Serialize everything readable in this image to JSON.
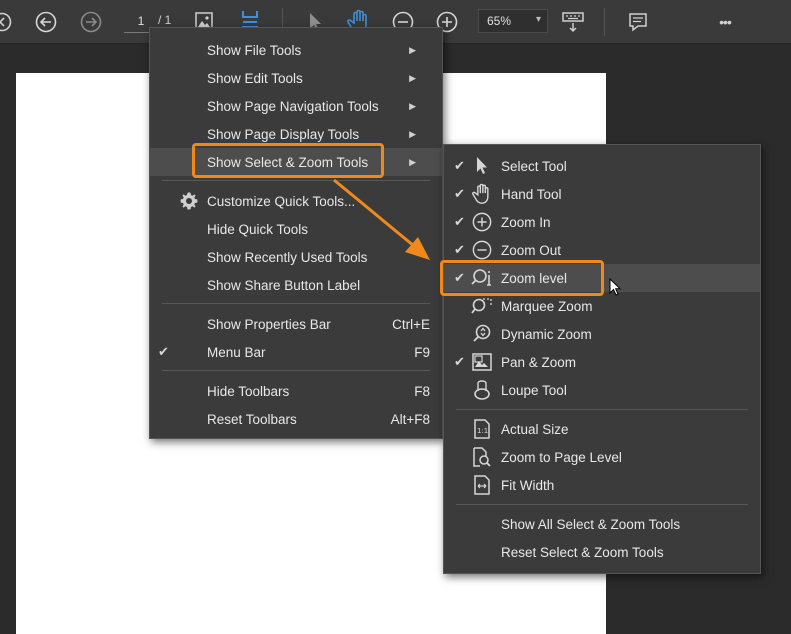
{
  "toolbar": {
    "page_current": "1",
    "page_total": "/ 1",
    "zoom": "65%",
    "zoom_caret": "▾",
    "more": "•••"
  },
  "main_menu": {
    "items": [
      {
        "label": "Show File Tools",
        "arrow": "▶"
      },
      {
        "label": "Show Edit Tools",
        "arrow": "▶"
      },
      {
        "label": "Show Page Navigation Tools",
        "arrow": "▶"
      },
      {
        "label": "Show Page Display Tools",
        "arrow": "▶"
      },
      {
        "label": "Show Select & Zoom Tools",
        "arrow": "▶"
      },
      {
        "label": "Customize Quick Tools..."
      },
      {
        "label": "Hide Quick Tools"
      },
      {
        "label": "Show Recently Used Tools"
      },
      {
        "label": "Show Share Button Label"
      },
      {
        "label": "Show Properties Bar",
        "shortcut": "Ctrl+E"
      },
      {
        "label": "Menu Bar",
        "shortcut": "F9",
        "check": "✔"
      },
      {
        "label": "Hide Toolbars",
        "shortcut": "F8"
      },
      {
        "label": "Reset Toolbars",
        "shortcut": "Alt+F8"
      }
    ]
  },
  "sub_menu": {
    "items": [
      {
        "label": "Select Tool",
        "check": "✔",
        "icon": "pointer-icon"
      },
      {
        "label": "Hand Tool",
        "check": "✔",
        "icon": "hand-icon"
      },
      {
        "label": "Zoom In",
        "check": "✔",
        "icon": "zoom-in-icon"
      },
      {
        "label": "Zoom Out",
        "check": "✔",
        "icon": "zoom-out-icon"
      },
      {
        "label": "Zoom level",
        "check": "✔",
        "icon": "zoom-level-icon"
      },
      {
        "label": "Marquee Zoom",
        "icon": "marquee-zoom-icon"
      },
      {
        "label": "Dynamic Zoom",
        "icon": "dynamic-zoom-icon"
      },
      {
        "label": "Pan & Zoom",
        "check": "✔",
        "icon": "pan-zoom-icon"
      },
      {
        "label": "Loupe Tool",
        "icon": "loupe-icon"
      },
      {
        "label": "Actual Size",
        "icon": "actual-size-icon"
      },
      {
        "label": "Zoom to Page Level",
        "icon": "zoom-page-icon"
      },
      {
        "label": "Fit Width",
        "icon": "fit-width-icon"
      },
      {
        "label": "Show All Select & Zoom Tools"
      },
      {
        "label": "Reset Select & Zoom Tools"
      }
    ]
  },
  "colors": {
    "highlight": "#f0891c",
    "accent_blue": "#3d8fe0"
  }
}
